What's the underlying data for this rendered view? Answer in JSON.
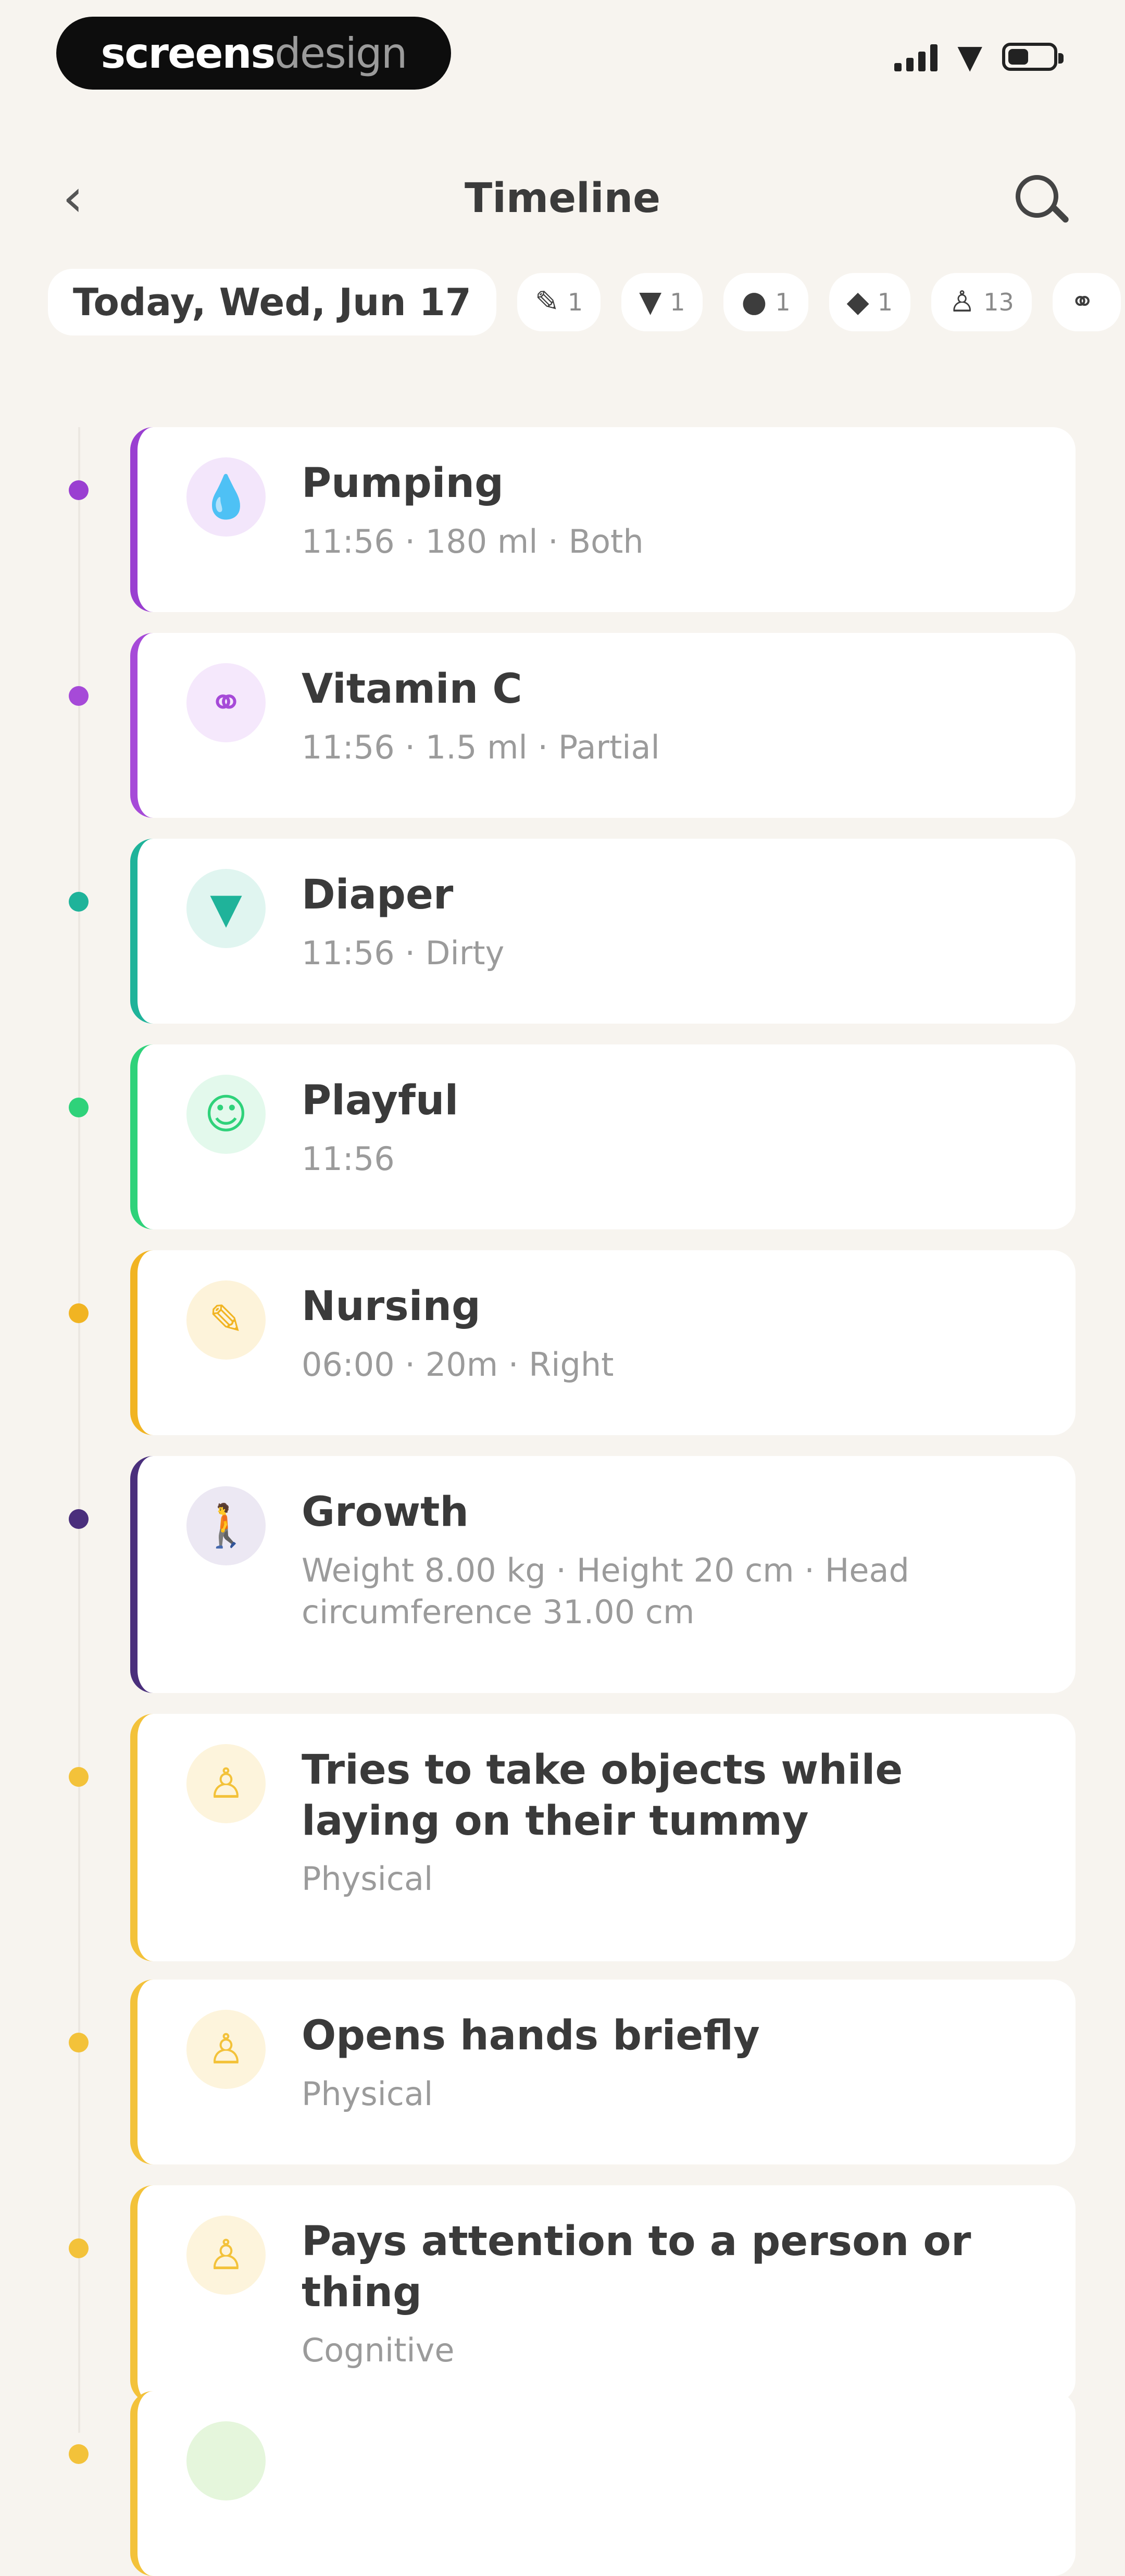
{
  "status_bar": {
    "brand_bold": "screens",
    "brand_light": "design"
  },
  "nav": {
    "title": "Timeline",
    "back_icon": "chevron-left-icon",
    "search_icon": "search-icon"
  },
  "filter": {
    "date_label": "Today, Wed, Jun 17",
    "chips": [
      {
        "icon": "bottle-icon",
        "glyph": "✎",
        "count": "1"
      },
      {
        "icon": "diaper-icon",
        "glyph": "▼",
        "count": "1"
      },
      {
        "icon": "mood-icon",
        "glyph": "●",
        "count": "1"
      },
      {
        "icon": "chat-icon",
        "glyph": "◆",
        "count": "1"
      },
      {
        "icon": "milestone-icon",
        "glyph": "♙",
        "count": "13"
      },
      {
        "icon": "medicine-icon",
        "glyph": "⚭",
        "count": ""
      }
    ]
  },
  "entries": [
    {
      "name": "Pumping",
      "detail": "11:56 · 180 ml · Both",
      "color": "#9a3fd1",
      "icon_bg": "#f3e6fb",
      "icon": "drop-icon",
      "glyph": "💧"
    },
    {
      "name": "Vitamin C",
      "detail": "11:56 · 1.5 ml · Partial",
      "color": "#a64ad8",
      "icon_bg": "#f5e8fc",
      "icon": "pills-icon",
      "glyph": "⚭"
    },
    {
      "name": "Diaper",
      "detail": "11:56 · Dirty",
      "color": "#1fb39a",
      "icon_bg": "#e0f5f0",
      "icon": "diaper-icon",
      "glyph": "▼"
    },
    {
      "name": "Playful",
      "detail": "11:56",
      "color": "#2fd27a",
      "icon_bg": "#e3f9ec",
      "icon": "smile-icon",
      "glyph": "☺"
    },
    {
      "name": "Nursing",
      "detail": "06:00 · 20m · Right",
      "color": "#f1b422",
      "icon_bg": "#fdf3da",
      "icon": "bottle-icon",
      "glyph": "✎"
    },
    {
      "name": "Growth",
      "detail": "Weight 8.00 kg · Height 20 cm · Head circumference 31.00 cm",
      "color": "#4a2f7c",
      "icon_bg": "#ece8f3",
      "icon": "child-icon",
      "glyph": "🚶"
    },
    {
      "name": "Tries to take objects while laying on their tummy",
      "detail": "Physical",
      "color": "#f3c23a",
      "icon_bg": "#fdf4dc",
      "icon": "baby-icon",
      "glyph": "♙"
    },
    {
      "name": "Opens hands briefly",
      "detail": "Physical",
      "color": "#f3c23a",
      "icon_bg": "#fdf4dc",
      "icon": "baby-icon",
      "glyph": "♙"
    },
    {
      "name": "Pays attention to a person or thing",
      "detail": "Cognitive",
      "color": "#f3c23a",
      "icon_bg": "#fdf4dc",
      "icon": "baby-icon",
      "glyph": "♙"
    },
    {
      "name": "",
      "detail": "",
      "color": "#f3c23a",
      "icon_bg": "#e5f6dc",
      "icon": "baby-icon",
      "glyph": ""
    }
  ]
}
